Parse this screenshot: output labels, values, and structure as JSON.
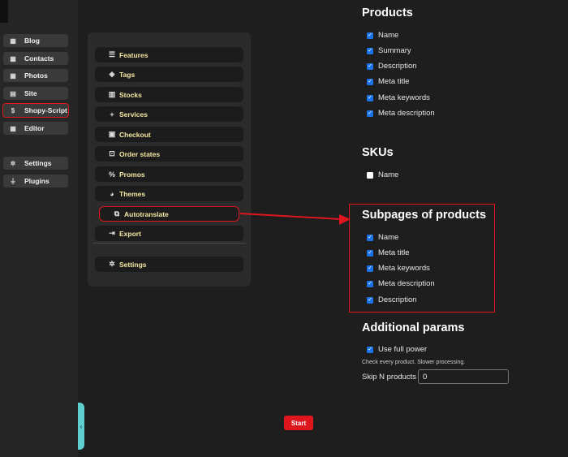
{
  "sidebar": {
    "items": [
      {
        "label": "Blog",
        "icon": "grid-icon"
      },
      {
        "label": "Contacts",
        "icon": "grid-icon"
      },
      {
        "label": "Photos",
        "icon": "grid-icon"
      },
      {
        "label": "Site",
        "icon": "file-icon"
      },
      {
        "label": "Shopy-Script",
        "icon": "dollar-icon"
      },
      {
        "label": "Editor",
        "icon": "grid-icon"
      }
    ],
    "bottom_items": [
      {
        "label": "Settings",
        "icon": "gear-icon"
      },
      {
        "label": "Plugins",
        "icon": "plug-icon"
      }
    ]
  },
  "panel": {
    "items": [
      {
        "label": "Features",
        "icon": "list-icon"
      },
      {
        "label": "Tags",
        "icon": "tag-icon"
      },
      {
        "label": "Stocks",
        "icon": "boxes-icon"
      },
      {
        "label": "Services",
        "icon": "plus-icon"
      },
      {
        "label": "Checkout",
        "icon": "clipboard-icon"
      },
      {
        "label": "Order states",
        "icon": "truck-icon"
      },
      {
        "label": "Promos",
        "icon": "percent-icon"
      },
      {
        "label": "Themes",
        "icon": "palette-icon"
      },
      {
        "label": "Autotranslate",
        "icon": "translate-icon"
      },
      {
        "label": "Export",
        "icon": "export-icon"
      }
    ],
    "settings_label": "Settings"
  },
  "products": {
    "title": "Products",
    "fields": [
      "Name",
      "Summary",
      "Description",
      "Meta title",
      "Meta keywords",
      "Meta description"
    ]
  },
  "skus": {
    "title": "SKUs",
    "fields": [
      "Name"
    ]
  },
  "subpages": {
    "title": "Subpages of products",
    "fields": [
      "Name",
      "Meta title",
      "Meta keywords",
      "Meta description",
      "Description"
    ]
  },
  "additional": {
    "title": "Additional params",
    "full_power_label": "Use full power",
    "hint": "Check every product. Slower processing.",
    "skip_label": "Skip N products",
    "skip_value": "0"
  },
  "start_label": "Start",
  "colors": {
    "accent": "#e0161e",
    "checkbox": "#1a73e8",
    "panel_text": "#f5e6a0"
  }
}
